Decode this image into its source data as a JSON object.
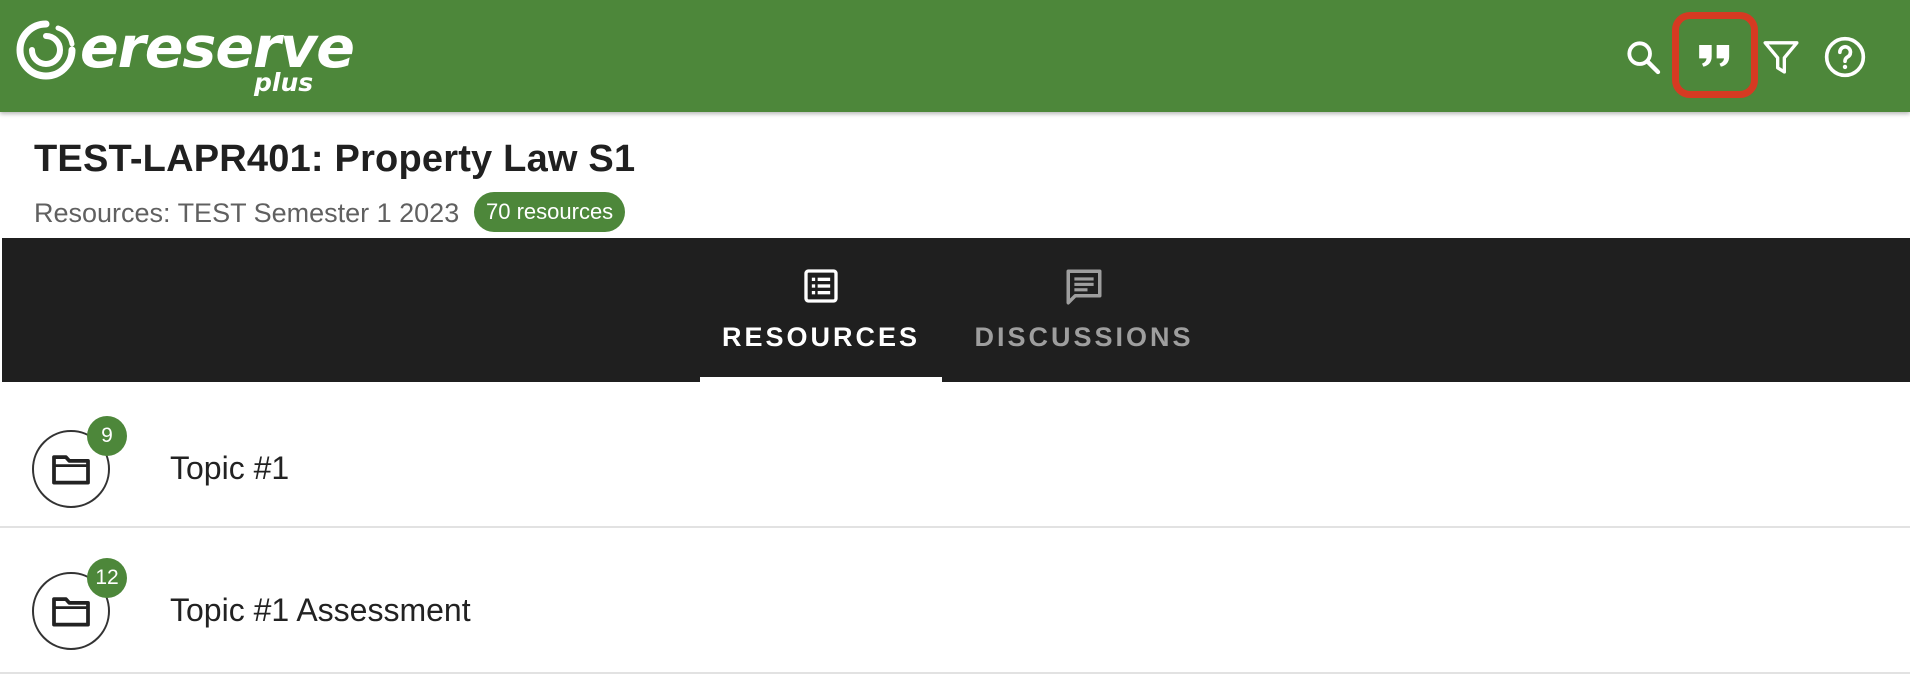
{
  "app": {
    "logo_text": "ereserve",
    "logo_sub": "plus",
    "brand_color": "#4d873a"
  },
  "toolbar": {
    "search_icon": "search-icon",
    "cite_icon": "quote-icon",
    "filter_icon": "filter-icon",
    "help_icon": "help-icon",
    "highlight_color": "#d63a22"
  },
  "course": {
    "title": "TEST-LAPR401: Property Law S1",
    "subtitle": "Resources: TEST Semester 1 2023",
    "resource_count": "70 resources"
  },
  "tabs": [
    {
      "label": "RESOURCES",
      "icon": "list-icon",
      "active": true
    },
    {
      "label": "DISCUSSIONS",
      "icon": "chat-icon",
      "active": false
    }
  ],
  "items": [
    {
      "label": "Topic #1",
      "count": "9",
      "icon": "folder-icon"
    },
    {
      "label": "Topic #1 Assessment",
      "count": "12",
      "icon": "folder-icon"
    }
  ]
}
